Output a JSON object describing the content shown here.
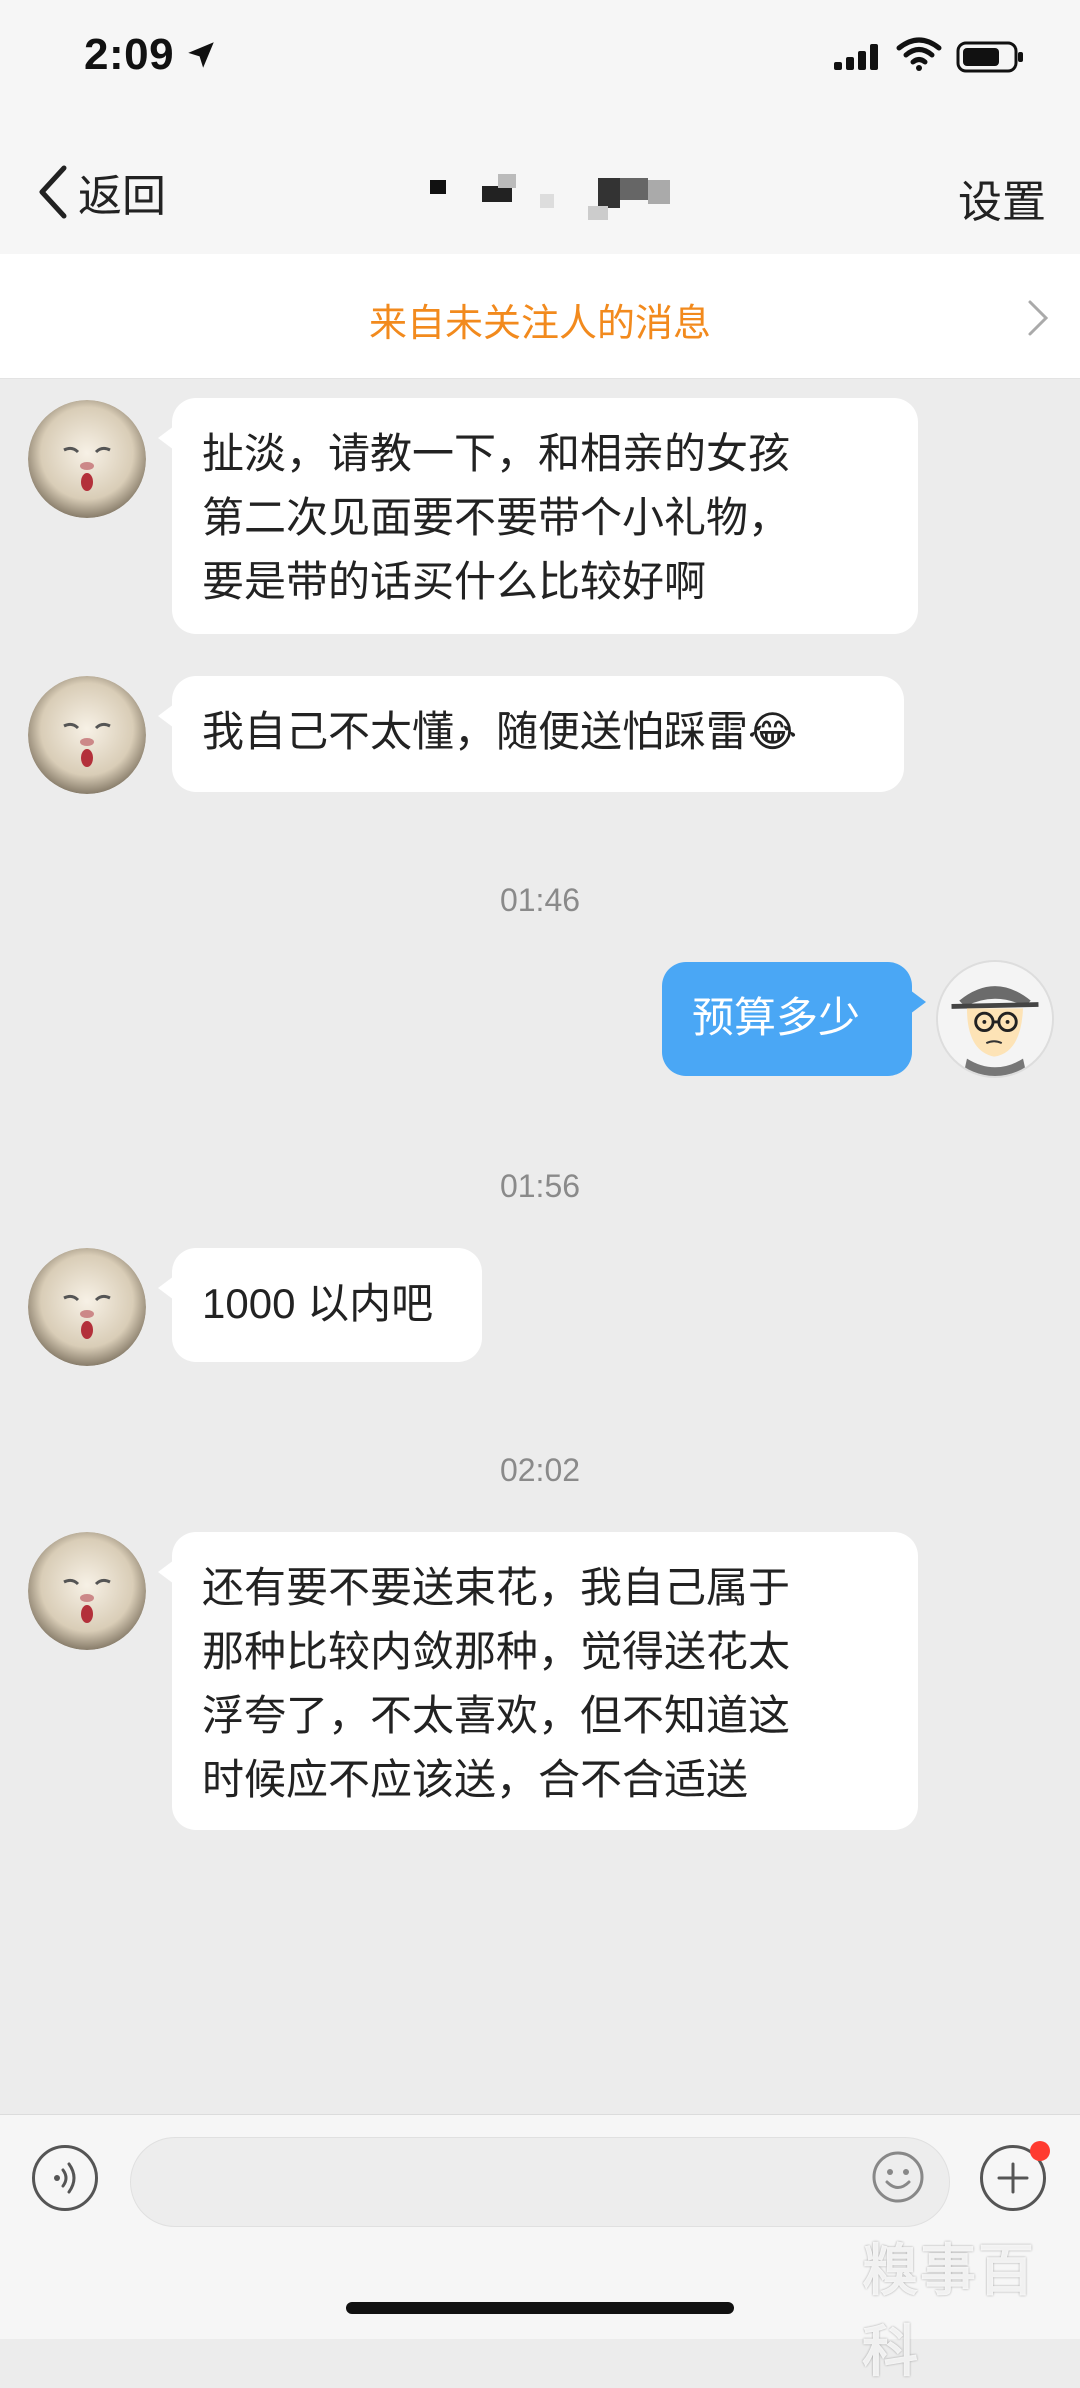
{
  "status_bar": {
    "time": "2:09"
  },
  "nav": {
    "back_label": "返回",
    "settings_label": "设置"
  },
  "banner": {
    "text": "来自未关注人的消息"
  },
  "messages": [
    {
      "side": "left",
      "text": "扯淡，请教一下，和相亲的女孩第二次见面要不要带个小礼物，要是带的话买什么比较好啊"
    },
    {
      "side": "left",
      "text": "我自己不太懂，随便送怕踩雷😂"
    },
    {
      "timestamp": "01:46"
    },
    {
      "side": "right",
      "text": "预算多少"
    },
    {
      "timestamp": "01:56"
    },
    {
      "side": "left",
      "text": "1000 以内吧"
    },
    {
      "timestamp": "02:02"
    },
    {
      "side": "left",
      "text": "还有要不要送束花，我自己属于那种比较内敛那种，觉得送花太浮夸了，不太喜欢，但不知道这时候应不应该送，合不合适送"
    }
  ],
  "msg_lines": {
    "m1": [
      "扯淡，请教一下，和相亲的女孩",
      "第二次见面要不要带个小礼物，",
      "要是带的话买什么比较好啊"
    ],
    "m2": "我自己不太懂，随便送怕踩雷😂",
    "m3": "预算多少",
    "m4": "1000 以内吧",
    "m5": [
      "还有要不要送束花，我自己属于",
      "那种比较内敛那种，觉得送花太",
      "浮夸了，不太喜欢，但不知道这",
      "时候应不应该送，合不合适送"
    ]
  },
  "timestamps": [
    "01:46",
    "01:56",
    "02:02"
  ],
  "watermark": "糗事百科",
  "colors": {
    "banner_text": "#f28a1d",
    "my_bubble": "#4aa7f5",
    "background": "#ececec",
    "unread_dot": "#ff3b30"
  }
}
